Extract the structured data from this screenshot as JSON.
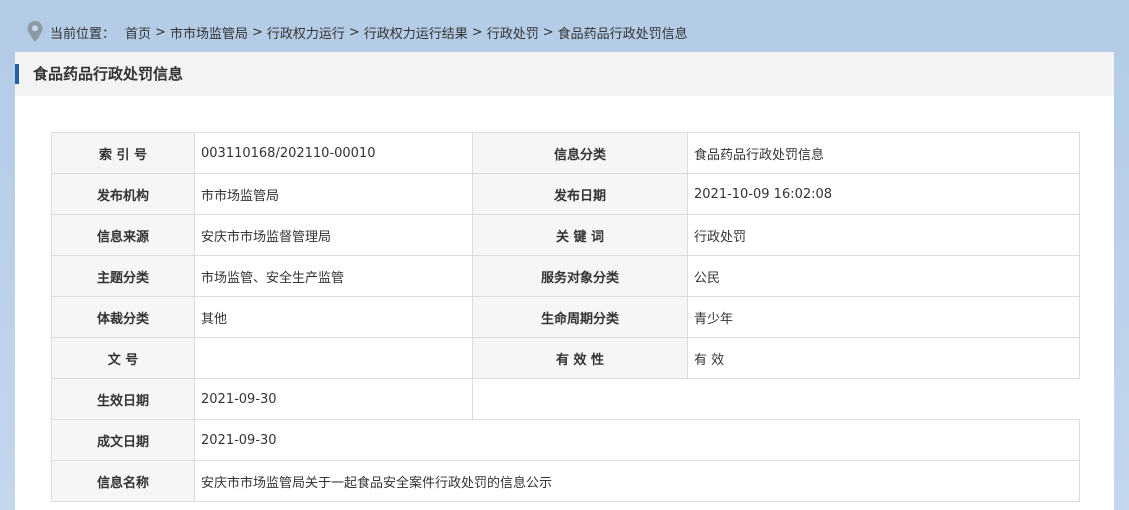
{
  "breadcrumb": {
    "label": "当前位置：",
    "items": [
      "首页",
      "市市场监管局",
      "行政权力运行",
      "行政权力运行结果",
      "行政处罚",
      "食品药品行政处罚信息"
    ],
    "separators": [
      " > ",
      " > ",
      "> ",
      "> ",
      "> "
    ]
  },
  "panel": {
    "title": "食品药品行政处罚信息"
  },
  "info": {
    "index_label": "索 引 号",
    "index_value": "003110168/202110-00010",
    "category_label": "信息分类",
    "category_value": "食品药品行政处罚信息",
    "org_label": "发布机构",
    "org_value": "市市场监管局",
    "date_label": "发布日期",
    "date_value": "2021-10-09 16:02:08",
    "source_label": "信息来源",
    "source_value": "安庆市市场监督管理局",
    "keywords_label": "关 键 词",
    "keywords_value": "行政处罚",
    "topic_label": "主题分类",
    "topic_value": "市场监管、安全生产监管",
    "audience_label": "服务对象分类",
    "audience_value": "公民",
    "genre_label": "体裁分类",
    "genre_value": "其他",
    "lifecycle_label": "生命周期分类",
    "lifecycle_value": "青少年",
    "docno_label": "文 号",
    "docno_value": "",
    "validity_label": "有 效 性",
    "validity_value": "有 效",
    "effective_label": "生效日期",
    "effective_value": "2021-09-30",
    "written_label": "成文日期",
    "written_value": "2021-09-30",
    "name_label": "信息名称",
    "name_value": "安庆市市场监管局关于一起食品安全案件行政处罚的信息公示"
  },
  "colors": {
    "accent_bar": "#1f5fa8",
    "page_bg": "#bcd2ea",
    "label_bg": "#f6f6f6",
    "border": "#dcdcdc"
  },
  "icons": {
    "location": "location-pin-icon"
  }
}
